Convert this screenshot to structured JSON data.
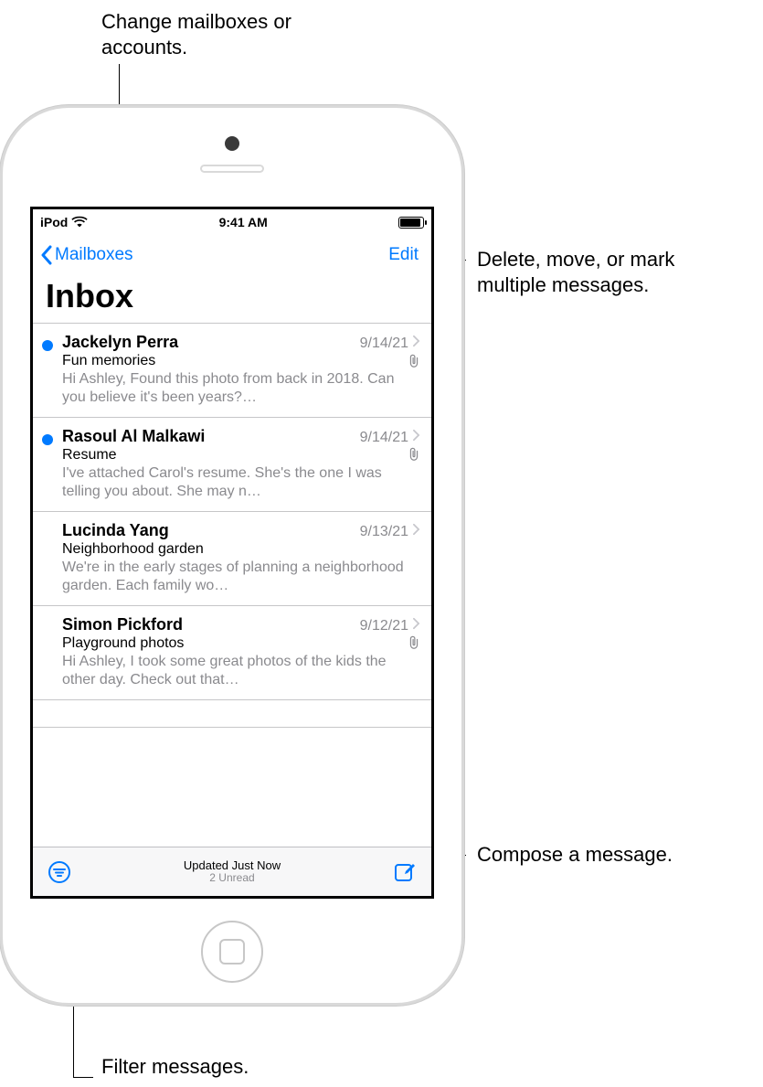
{
  "callouts": {
    "mailboxes": "Change mailboxes or accounts.",
    "edit": "Delete, move, or mark multiple messages.",
    "compose": "Compose a message.",
    "filter": "Filter messages."
  },
  "statusbar": {
    "carrier": "iPod",
    "time": "9:41 AM"
  },
  "navbar": {
    "back_label": "Mailboxes",
    "edit_label": "Edit"
  },
  "title": "Inbox",
  "messages": [
    {
      "unread": true,
      "sender": "Jackelyn Perra",
      "date": "9/14/21",
      "subject": "Fun memories",
      "attachment": true,
      "preview": "Hi Ashley, Found this photo from back in 2018. Can you believe it's been years?…"
    },
    {
      "unread": true,
      "sender": "Rasoul Al Malkawi",
      "date": "9/14/21",
      "subject": "Resume",
      "attachment": true,
      "preview": "I've attached Carol's resume. She's the one I was telling you about. She may n…"
    },
    {
      "unread": false,
      "sender": "Lucinda Yang",
      "date": "9/13/21",
      "subject": "Neighborhood garden",
      "attachment": false,
      "preview": "We're in the early stages of planning a neighborhood garden. Each family wo…"
    },
    {
      "unread": false,
      "sender": "Simon Pickford",
      "date": "9/12/21",
      "subject": "Playground photos",
      "attachment": true,
      "preview": "Hi Ashley, I took some great photos of the kids the other day. Check out that…"
    }
  ],
  "toolbar": {
    "status_line1": "Updated Just Now",
    "status_line2": "2 Unread"
  }
}
